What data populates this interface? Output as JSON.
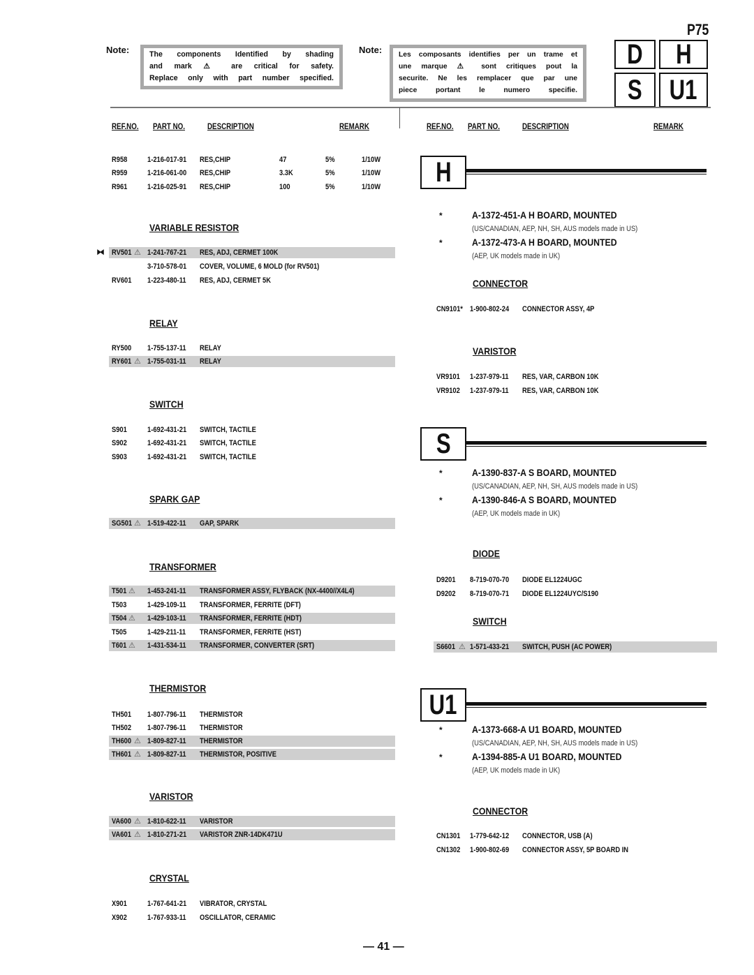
{
  "header": {
    "page_code": "P75",
    "board_grid": [
      "D",
      "H",
      "S",
      "U1"
    ],
    "note_label": "Note:",
    "note_en": [
      "The components Identified by shading",
      "and mark ⚠  are critical for safety.",
      "Replace only with part number specified."
    ],
    "note_fr": [
      "Les composants identifies per un trame et",
      "une marque ⚠ sont critiques pout la",
      "securite.  Ne les remplacer que par une",
      "piece  portant  le  numero  specifie."
    ]
  },
  "columns": {
    "ref": "REF.NO.",
    "part": "PART NO.",
    "desc": "DESCRIPTION",
    "remark": "REMARK"
  },
  "left": {
    "resistors": [
      {
        "ref": "R958",
        "part": "1-216-017-91",
        "desc": "RES,CHIP",
        "value": "47",
        "tol": "5%",
        "watt": "1/10W"
      },
      {
        "ref": "R959",
        "part": "1-216-061-00",
        "desc": "RES,CHIP",
        "value": "3.3K",
        "tol": "5%",
        "watt": "1/10W"
      },
      {
        "ref": "R961",
        "part": "1-216-025-91",
        "desc": "RES,CHIP",
        "value": "100",
        "tol": "5%",
        "watt": "1/10W"
      }
    ],
    "sections": [
      {
        "title": "VARIABLE RESISTOR",
        "rows": [
          {
            "ref": "RV501",
            "warn": true,
            "part": "1-241-767-21",
            "desc": "RES, ADJ, CERMET 100K",
            "shaded": true,
            "marker": "⧓"
          },
          {
            "ref": "",
            "warn": false,
            "part": "3-710-578-01",
            "desc": "COVER, VOLUME, 6 MOLD (for RV501)",
            "shaded": false
          },
          {
            "ref": "RV601",
            "warn": false,
            "part": "1-223-480-11",
            "desc": "RES, ADJ, CERMET 5K",
            "shaded": false
          }
        ]
      },
      {
        "title": "RELAY",
        "rows": [
          {
            "ref": "RY500",
            "warn": false,
            "part": "1-755-137-11",
            "desc": "RELAY",
            "shaded": false
          },
          {
            "ref": "RY601",
            "warn": true,
            "part": "1-755-031-11",
            "desc": "RELAY",
            "shaded": true
          }
        ]
      },
      {
        "title": "SWITCH",
        "rows": [
          {
            "ref": "S901",
            "warn": false,
            "part": "1-692-431-21",
            "desc": "SWITCH, TACTILE",
            "shaded": false
          },
          {
            "ref": "S902",
            "warn": false,
            "part": "1-692-431-21",
            "desc": "SWITCH, TACTILE",
            "shaded": false
          },
          {
            "ref": "S903",
            "warn": false,
            "part": "1-692-431-21",
            "desc": "SWITCH, TACTILE",
            "shaded": false
          }
        ]
      },
      {
        "title": "SPARK GAP",
        "rows": [
          {
            "ref": "SG501",
            "warn": true,
            "part": "1-519-422-11",
            "desc": "GAP, SPARK",
            "shaded": true
          }
        ]
      },
      {
        "title": "TRANSFORMER",
        "rows": [
          {
            "ref": "T501",
            "warn": true,
            "part": "1-453-241-11",
            "desc": "TRANSFORMER ASSY, FLYBACK (NX-4400//X4L4)",
            "shaded": true
          },
          {
            "ref": "T503",
            "warn": false,
            "part": "1-429-109-11",
            "desc": "TRANSFORMER, FERRITE (DFT)",
            "shaded": false
          },
          {
            "ref": "T504",
            "warn": true,
            "part": "1-429-103-11",
            "desc": "TRANSFORMER, FERRITE (HDT)",
            "shaded": true
          },
          {
            "ref": "T505",
            "warn": false,
            "part": "1-429-211-11",
            "desc": "TRANSFORMER, FERRITE (HST)",
            "shaded": false
          },
          {
            "ref": "T601",
            "warn": true,
            "part": "1-431-534-11",
            "desc": "TRANSFORMER, CONVERTER (SRT)",
            "shaded": true
          }
        ]
      },
      {
        "title": "THERMISTOR",
        "rows": [
          {
            "ref": "TH501",
            "warn": false,
            "part": "1-807-796-11",
            "desc": "THERMISTOR",
            "shaded": false
          },
          {
            "ref": "TH502",
            "warn": false,
            "part": "1-807-796-11",
            "desc": "THERMISTOR",
            "shaded": false
          },
          {
            "ref": "TH600",
            "warn": true,
            "part": "1-809-827-11",
            "desc": "THERMISTOR",
            "shaded": true
          },
          {
            "ref": "TH601",
            "warn": true,
            "part": "1-809-827-11",
            "desc": "THERMISTOR, POSITIVE",
            "shaded": true
          }
        ]
      },
      {
        "title": "VARISTOR",
        "rows": [
          {
            "ref": "VA600",
            "warn": true,
            "part": "1-810-622-11",
            "desc": "VARISTOR",
            "shaded": true
          },
          {
            "ref": "VA601",
            "warn": true,
            "part": "1-810-271-21",
            "desc": "VARISTOR ZNR-14DK471U",
            "shaded": true
          }
        ]
      },
      {
        "title": "CRYSTAL",
        "rows": [
          {
            "ref": "X901",
            "warn": false,
            "part": "1-767-641-21",
            "desc": "VIBRATOR, CRYSTAL",
            "shaded": false
          },
          {
            "ref": "X902",
            "warn": false,
            "part": "1-767-933-11",
            "desc": "OSCILLATOR, CERAMIC",
            "shaded": false
          }
        ]
      }
    ]
  },
  "right": {
    "boards": [
      {
        "letter": "H",
        "mounted": [
          {
            "star": "*",
            "title": "A-1372-451-A  H BOARD,  MOUNTED",
            "note": "(US/CANADIAN, AEP, NH, SH, AUS models made in US)"
          },
          {
            "star": "*",
            "title": "A-1372-473-A  H BOARD,  MOUNTED",
            "note": "(AEP, UK models made in UK)"
          }
        ],
        "sections": [
          {
            "title": "CONNECTOR",
            "rows": [
              {
                "ref": "CN9101*",
                "warn": false,
                "part": "1-900-802-24",
                "desc": "CONNECTOR ASSY, 4P",
                "shaded": false
              }
            ]
          },
          {
            "title": "VARISTOR",
            "rows": [
              {
                "ref": "VR9101",
                "warn": false,
                "part": "1-237-979-11",
                "desc": "RES, VAR, CARBON 10K",
                "shaded": false
              },
              {
                "ref": "VR9102",
                "warn": false,
                "part": "1-237-979-11",
                "desc": "RES, VAR, CARBON 10K",
                "shaded": false
              }
            ]
          }
        ]
      },
      {
        "letter": "S",
        "mounted": [
          {
            "star": "*",
            "title": "A-1390-837-A  S BOARD,  MOUNTED",
            "note": "(US/CANADIAN, AEP, NH, SH, AUS models made in US)"
          },
          {
            "star": "*",
            "title": "A-1390-846-A  S BOARD,  MOUNTED",
            "note": "(AEP, UK models made in UK)"
          }
        ],
        "sections": [
          {
            "title": "DIODE",
            "rows": [
              {
                "ref": "D9201",
                "warn": false,
                "part": "8-719-070-70",
                "desc": "DIODE EL1224UGC",
                "shaded": false
              },
              {
                "ref": "D9202",
                "warn": false,
                "part": "8-719-070-71",
                "desc": "DIODE EL1224UYC/S190",
                "shaded": false
              }
            ]
          },
          {
            "title": "SWITCH",
            "rows": [
              {
                "ref": "S6601",
                "warn": true,
                "part": "1-571-433-21",
                "desc": "SWITCH, PUSH (AC POWER)",
                "shaded": true
              }
            ]
          }
        ]
      },
      {
        "letter": "U1",
        "mounted": [
          {
            "star": "*",
            "title": "A-1373-668-A  U1 BOARD,  MOUNTED",
            "note": "(US/CANADIAN, AEP, NH, SH, AUS models made in US)"
          },
          {
            "star": "*",
            "title": "A-1394-885-A  U1 BOARD, MOUNTED",
            "note": "(AEP, UK models made in UK)"
          }
        ],
        "sections": [
          {
            "title": "CONNECTOR",
            "rows": [
              {
                "ref": "CN1301",
                "warn": false,
                "part": "1-779-642-12",
                "desc": "CONNECTOR, USB (A)",
                "shaded": false
              },
              {
                "ref": "CN1302",
                "warn": false,
                "part": "1-900-802-69",
                "desc": "CONNECTOR ASSY, 5P BOARD IN",
                "shaded": false
              }
            ]
          }
        ]
      }
    ]
  },
  "footer": {
    "page_number": "— 41 —"
  },
  "warn_symbol": "⚠"
}
